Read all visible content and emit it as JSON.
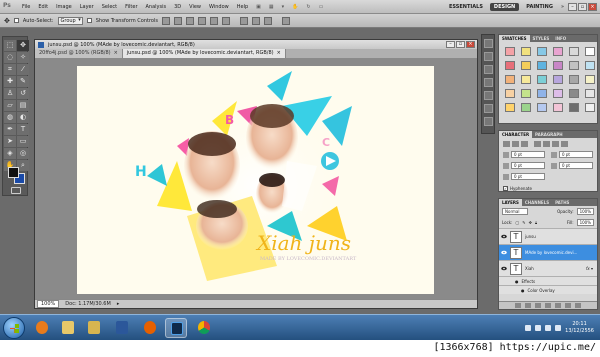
{
  "menubar": {
    "logo": "Ps",
    "items": [
      "File",
      "Edit",
      "Image",
      "Layer",
      "Select",
      "Filter",
      "Analysis",
      "3D",
      "View",
      "Window",
      "Help"
    ],
    "workspaces": [
      "ESSENTIALS",
      "DESIGN",
      "PAINTING"
    ],
    "active_workspace": "DESIGN"
  },
  "options": {
    "auto_select_label": "Auto-Select:",
    "auto_select_value": "Group",
    "transform_label": "Show Transform Controls"
  },
  "document": {
    "window_title": "junsu.psd @ 100% (MAde by lovecomic.deviantart, RGB/8)",
    "tabs": [
      {
        "label": "20ffo4j.psd @ 100% (RGB/8)",
        "close": "×"
      },
      {
        "label": "junsu.psd @ 100% (MAde by lovecomic.deviantart, RGB/8)",
        "close": "×"
      }
    ],
    "zoom": "100%",
    "doc_info": "Doc: 1.17M/30.6M"
  },
  "artwork": {
    "script_text": "Xiah juns",
    "caption": "MADE BY LOVECOMIC.DEVIANTART"
  },
  "panels": {
    "swatch_tabs": [
      "SWATCHES",
      "STYLES",
      "INFO"
    ],
    "swatches": [
      "#f4a2a6",
      "#f1e17e",
      "#86c8e6",
      "#e8a4d0",
      "#d9d9d9",
      "#ffffff",
      "#e86f79",
      "#f3cd5a",
      "#5fb3e0",
      "#c886c6",
      "#c2c2c2",
      "#bfe2f2",
      "#f2b27a",
      "#f6e99a",
      "#7ccfd6",
      "#b7a6dd",
      "#a7a7a7",
      "#f5f1c7",
      "#f7d1a3",
      "#c4e38c",
      "#8fb3e8",
      "#ddbde8",
      "#8a8a8a",
      "#e6e6e6",
      "#ffd36b",
      "#9bd48c",
      "#b5c9f0",
      "#f2c4d6",
      "#6e6e6e",
      "#f0f0f0"
    ],
    "char_tabs": [
      "CHARACTER",
      "PARAGRAPH"
    ],
    "char_fields": [
      "0 pt",
      "0 pt",
      "0 pt",
      "0 pt",
      "0 pt",
      "0 pt"
    ],
    "hyphenate_label": "Hyphenate",
    "layer_tabs": [
      "LAYERS",
      "CHANNELS",
      "PATHS"
    ],
    "blend_mode": "Normal",
    "opacity_label": "Opacity:",
    "opacity_value": "100%",
    "lock_label": "Lock:",
    "fill_label": "Fill:",
    "fill_value": "100%",
    "layers": [
      {
        "name": "junsu",
        "thumb": "T"
      },
      {
        "name": "MAde by lovecomic.devi...",
        "thumb": "T"
      },
      {
        "name": "Xiah",
        "thumb": "T"
      }
    ],
    "effects_label": "Effects",
    "color_overlay_label": "Color Overlay"
  },
  "taskbar": {
    "time": "20:11",
    "date": "13/12/2556"
  },
  "watermark": "[1366x768] https://upic.me/"
}
